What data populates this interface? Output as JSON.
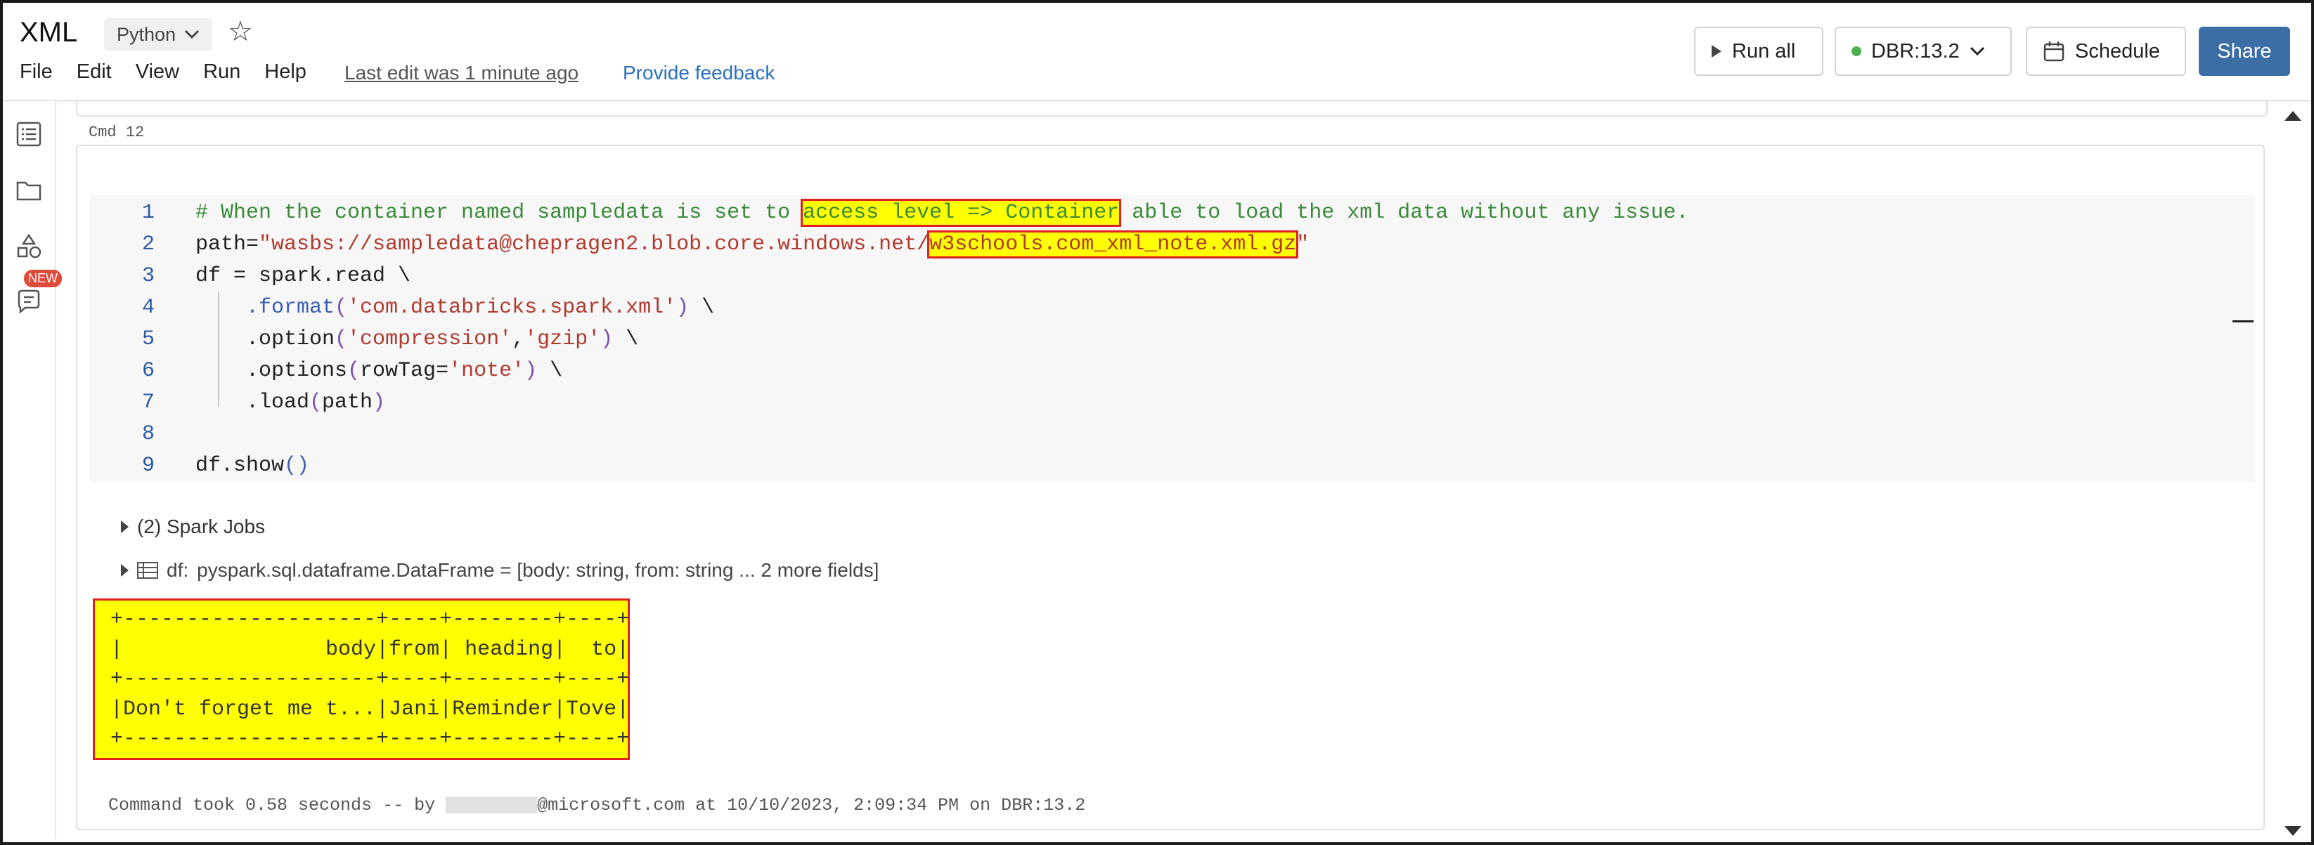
{
  "header": {
    "title": "XML",
    "language": "Python",
    "menu": [
      "File",
      "Edit",
      "View",
      "Run",
      "Help"
    ],
    "last_edit": "Last edit was 1 minute ago",
    "feedback": "Provide feedback",
    "run_all": "Run all",
    "cluster": "DBR:13.2",
    "schedule": "Schedule",
    "share": "Share"
  },
  "sidebar": {
    "badge": "NEW"
  },
  "cell": {
    "cmd_label": "Cmd  12",
    "line_numbers": [
      "1",
      "2",
      "3",
      "4",
      "5",
      "6",
      "7",
      "8",
      "9"
    ],
    "spark_jobs": "(2) Spark Jobs",
    "df_label": "df:",
    "df_schema": "pyspark.sql.dataframe.DataFrame = [body: string, from: string ... 2 more fields]",
    "output": [
      "+--------------------+----+--------+----+",
      "|                body|from| heading|  to|",
      "+--------------------+----+--------+----+",
      "|Don't forget me t...|Jani|Reminder|Tove|",
      "+--------------------+----+--------+----+"
    ],
    "took_prefix": "Command took 0.58 seconds -- by ",
    "took_suffix": "@microsoft.com at 10/10/2023, 2:09:34 PM on DBR:13.2"
  },
  "code": {
    "l1_comment": "# When the container named sampledata is set to ",
    "l1_highlight": "access level => Container",
    "l1_rest": " able to load the xml data without any issue.",
    "l2_start": "path=",
    "l2_str": "\"wasbs://sampledata@chepragen2.blob.core.windows.net/",
    "l2_highlight": "w3schools.com_xml_note.xml.gz",
    "l2_end": "\"",
    "l3": "df = spark.read \\",
    "l4_fn": ".format",
    "l4_arg": "'com.databricks.spark.xml'",
    "l5_fn": ".option",
    "l5_arg1": "'compression'",
    "l5_arg2": "'gzip'",
    "l6_fn": ".options",
    "l6_kw": "rowTag=",
    "l6_arg": "'note'",
    "l7_fn": ".load",
    "l7_arg": "path",
    "l9": "df.show",
    "backslash": " \\"
  },
  "colors": {
    "share": "#3a6ea5",
    "highlight": "#ffff00",
    "highlight_border": "#e02020",
    "status_dot": "#4caf50"
  }
}
